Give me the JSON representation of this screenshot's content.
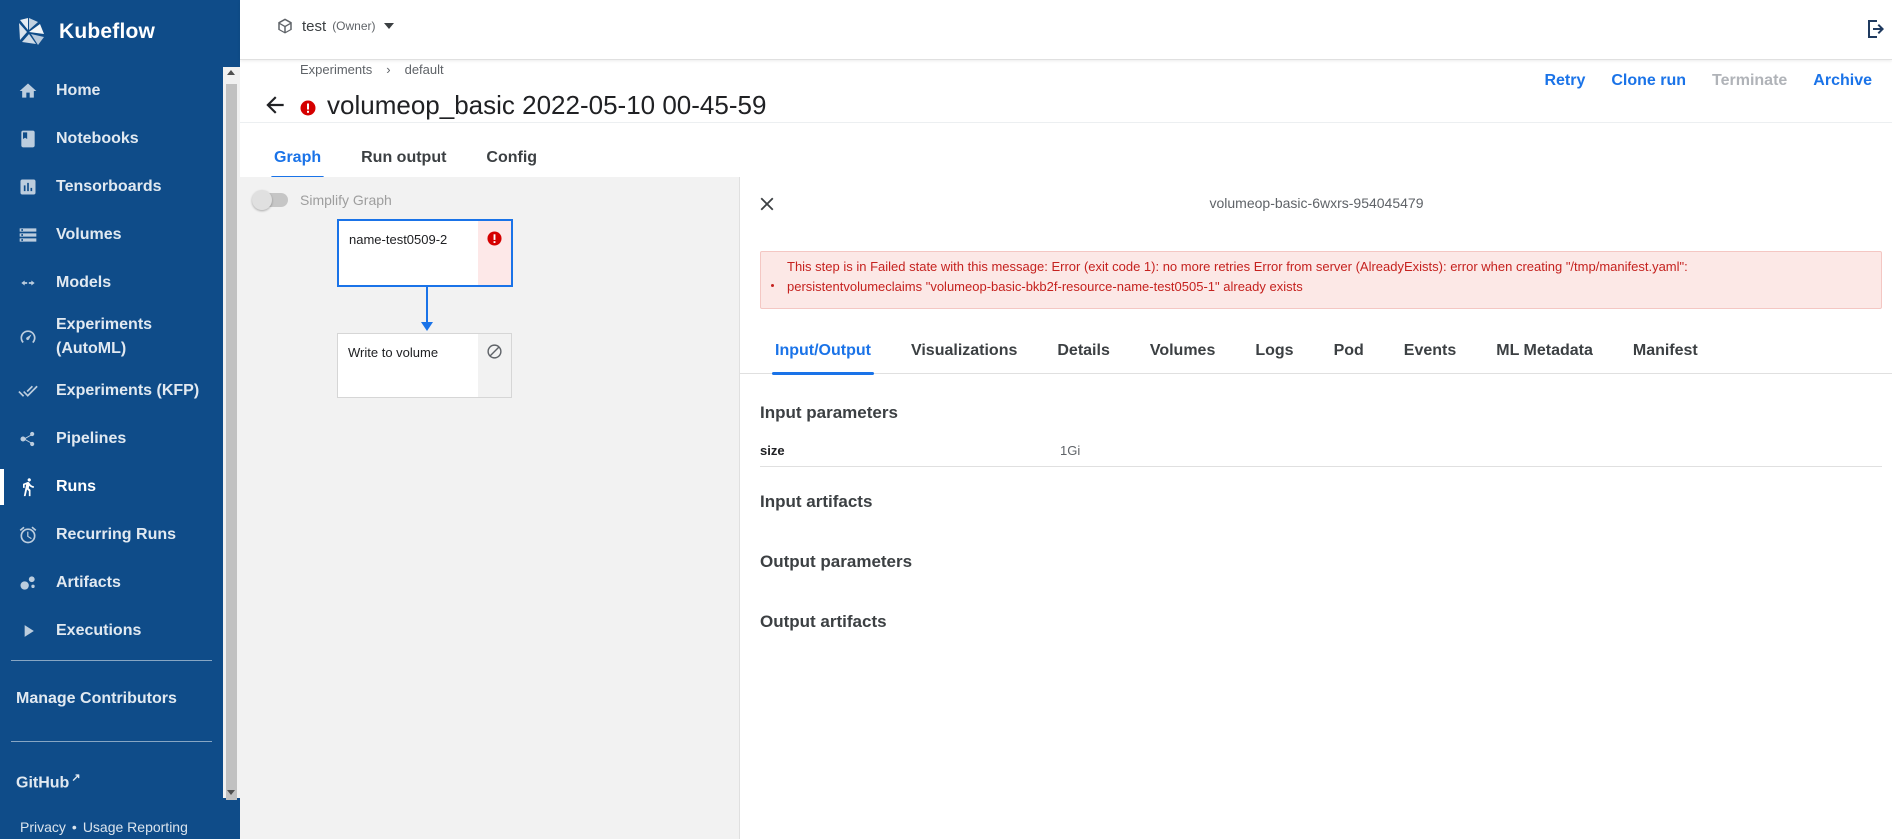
{
  "brand": {
    "name": "Kubeflow"
  },
  "sidebar": {
    "items": [
      {
        "label": "Home",
        "icon": "home-icon",
        "active": false
      },
      {
        "label": "Notebooks",
        "icon": "book-icon",
        "active": false
      },
      {
        "label": "Tensorboards",
        "icon": "chart-icon",
        "active": false
      },
      {
        "label": "Volumes",
        "icon": "storage-icon",
        "active": false
      },
      {
        "label": "Models",
        "icon": "code-arrows-icon",
        "active": false
      },
      {
        "label": "Experiments (AutoML)",
        "icon": "speed-gauge-icon",
        "active": false
      },
      {
        "label": "Experiments (KFP)",
        "icon": "done-all-icon",
        "active": false
      },
      {
        "label": "Pipelines",
        "icon": "pipeline-icon",
        "active": false
      },
      {
        "label": "Runs",
        "icon": "runner-icon",
        "active": true
      },
      {
        "label": "Recurring Runs",
        "icon": "alarm-icon",
        "active": false
      },
      {
        "label": "Artifacts",
        "icon": "bubbles-icon",
        "active": false
      },
      {
        "label": "Executions",
        "icon": "play-arrow-icon",
        "active": false
      }
    ],
    "manage_contributors": "Manage Contributors",
    "github": "GitHub",
    "privacy": "Privacy",
    "dot": "•",
    "usage_reporting": "Usage Reporting"
  },
  "topbar": {
    "namespace": "test",
    "role": "(Owner)"
  },
  "breadcrumb": {
    "items": [
      "Experiments",
      "default"
    ],
    "separator": "›"
  },
  "page": {
    "title": "volumeop_basic 2022-05-10 00-45-59",
    "status": "error"
  },
  "actions": {
    "retry": "Retry",
    "clone_run": "Clone run",
    "terminate": "Terminate",
    "archive": "Archive"
  },
  "main_tabs": {
    "graph": "Graph",
    "run_output": "Run output",
    "config": "Config"
  },
  "graph": {
    "simplify_label": "Simplify Graph",
    "nodes": [
      {
        "label": "name-test0509-2",
        "status": "error"
      },
      {
        "label": "Write to volume",
        "status": "skipped"
      }
    ]
  },
  "panel": {
    "title": "volumeop-basic-6wxrs-954045479",
    "error_message_line1": "This step is in Failed state with this message: Error (exit code 1): no more retries Error from server (AlreadyExists): error when creating \"/tmp/manifest.yaml\":",
    "error_message_line2": "persistentvolumeclaims \"volumeop-basic-bkb2f-resource-name-test0505-1\" already exists",
    "tabs": [
      "Input/Output",
      "Visualizations",
      "Details",
      "Volumes",
      "Logs",
      "Pod",
      "Events",
      "ML Metadata",
      "Manifest"
    ],
    "active_tab": "Input/Output",
    "sections": {
      "input_parameters": "Input parameters",
      "input_artifacts": "Input artifacts",
      "output_parameters": "Output parameters",
      "output_artifacts": "Output artifacts"
    },
    "params": [
      {
        "key": "size",
        "value": "1Gi"
      }
    ]
  },
  "colors": {
    "sidebar_bg": "#0f4c89",
    "accent": "#1a73e8",
    "error": "#c5221f",
    "error_bg": "#fce8e6"
  }
}
